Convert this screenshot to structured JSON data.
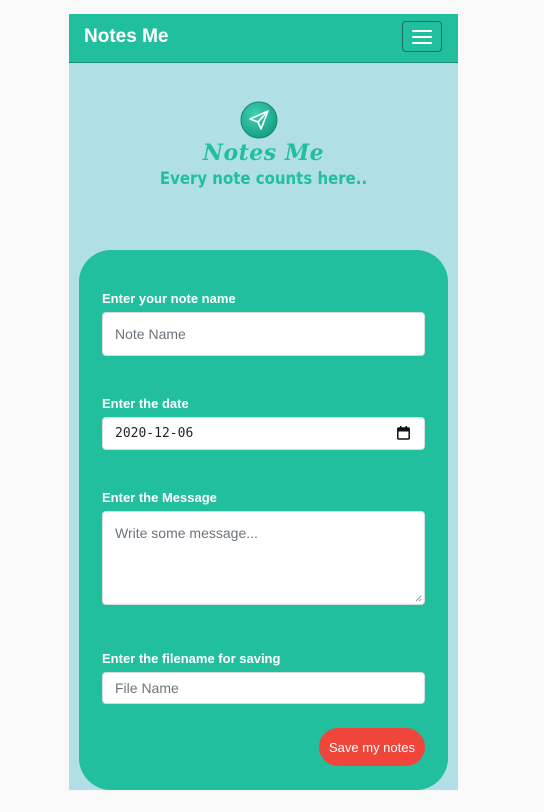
{
  "navbar": {
    "brand": "Notes Me",
    "menu_icon": "hamburger-menu-icon"
  },
  "hero": {
    "icon": "paper-plane-icon",
    "title": "Notes Me",
    "tagline": "Every note counts here.."
  },
  "form": {
    "note_name": {
      "label": "Enter your note name",
      "placeholder": "Note Name"
    },
    "date": {
      "label": "Enter the date",
      "value": "2020-12-06",
      "icon": "calendar-icon"
    },
    "message": {
      "label": "Enter the Message",
      "placeholder": "Write some message..."
    },
    "filename": {
      "label": "Enter the filename for saving",
      "placeholder": "File Name"
    },
    "save_label": "Save my notes"
  },
  "colors": {
    "accent": "#22bf9f",
    "background": "#b0dfe6",
    "button": "#f0453a"
  }
}
